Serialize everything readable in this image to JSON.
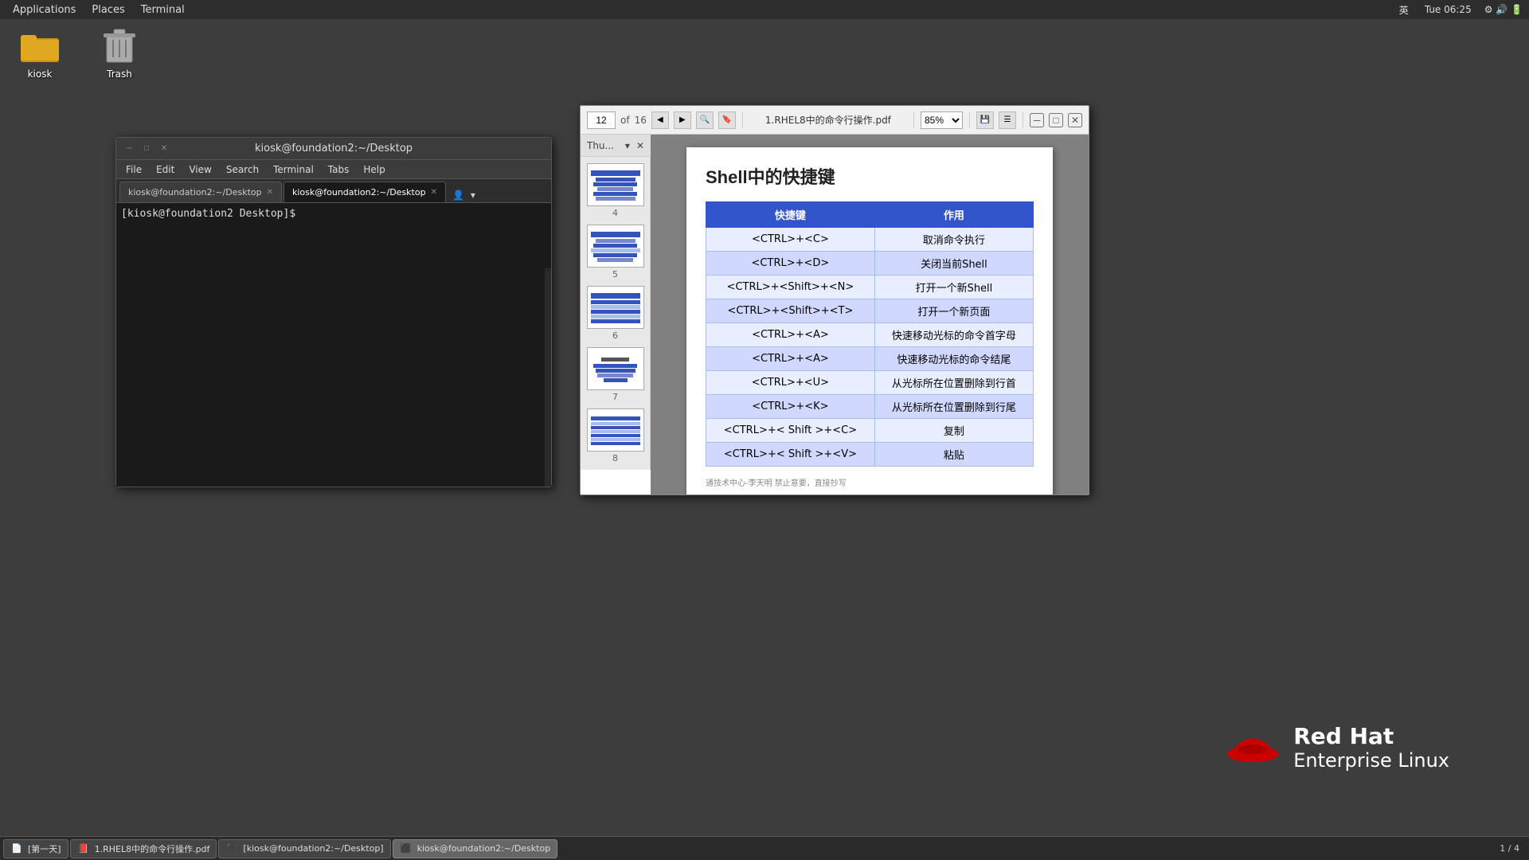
{
  "topbar": {
    "applications_label": "Applications",
    "places_label": "Places",
    "terminal_label": "Terminal",
    "lang": "英",
    "time": "Tue 06:25"
  },
  "desktop": {
    "icons": [
      {
        "id": "kiosk",
        "label": "kiosk",
        "type": "folder"
      },
      {
        "id": "trash",
        "label": "Trash",
        "type": "trash"
      }
    ]
  },
  "terminal_window": {
    "title": "kiosk@foundation2:~/Desktop",
    "menubar": [
      "File",
      "Edit",
      "View",
      "Search",
      "Terminal",
      "Tabs",
      "Help"
    ],
    "tabs": [
      {
        "label": "kiosk@foundation2:~/Desktop",
        "active": false
      },
      {
        "label": "kiosk@foundation2:~/Desktop",
        "active": true
      }
    ],
    "prompt": "[kiosk@foundation2 Desktop]$ "
  },
  "pdf_viewer": {
    "current_page": "12",
    "total_pages": "16",
    "title": "1.RHEL8中的命令行操作.pdf",
    "zoom": "85%",
    "thumbnails_header": "Thu...",
    "thumbnails": [
      {
        "num": "4"
      },
      {
        "num": "5"
      },
      {
        "num": "6"
      },
      {
        "num": "7"
      },
      {
        "num": "8"
      }
    ],
    "page_title": "Shell中的快捷键",
    "table": {
      "headers": [
        "快捷键",
        "作用"
      ],
      "rows": [
        [
          "<CTRL>+<C>",
          "取消命令执行"
        ],
        [
          "<CTRL>+<D>",
          "关闭当前Shell"
        ],
        [
          "<CTRL>+<Shift>+<N>",
          "打开一个新Shell"
        ],
        [
          "<CTRL>+<Shift>+<T>",
          "打开一个新页面"
        ],
        [
          "<CTRL>+<A>",
          "快速移动光标的命令首字母"
        ],
        [
          "<CTRL>+<A>",
          "快速移动光标的命令结尾"
        ],
        [
          "<CTRL>+<U>",
          "从光标所在位置删除到行首"
        ],
        [
          "<CTRL>+<K>",
          "从光标所在位置删除到行尾"
        ],
        [
          "<CTRL>+< Shift >+<C>",
          "复制"
        ],
        [
          "<CTRL>+< Shift >+<V>",
          "粘贴"
        ]
      ]
    },
    "footer": "通技术中心-李天明  禁止意要，直接抄写"
  },
  "redhat": {
    "line1": "Red Hat",
    "line2": "Enterprise Linux"
  },
  "taskbar": {
    "items": [
      {
        "label": "[第一天]",
        "type": "doc",
        "active": false
      },
      {
        "label": "1.RHEL8中的命令行操作.pdf",
        "type": "pdf",
        "active": false
      },
      {
        "label": "[kiosk@foundation2:~/Desktop]",
        "type": "terminal",
        "active": false
      },
      {
        "label": "kiosk@foundation2:~/Desktop",
        "type": "terminal",
        "active": true
      }
    ],
    "right_text": "1 / 4"
  }
}
